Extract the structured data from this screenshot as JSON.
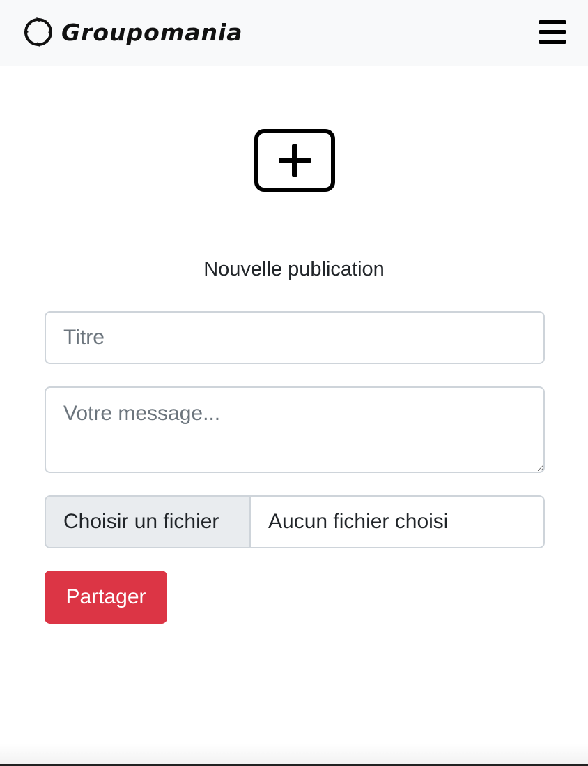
{
  "navbar": {
    "brand_name": "Groupomania",
    "logo_icon": "groupomania-logo-icon",
    "menu_icon": "hamburger-menu-icon"
  },
  "hero": {
    "icon": "plus-square-icon"
  },
  "form": {
    "title": "Nouvelle publication",
    "title_placeholder": "Titre",
    "title_value": "",
    "message_placeholder": "Votre message...",
    "message_value": "",
    "file_button_label": "Choisir un fichier",
    "file_status": "Aucun fichier choisi",
    "submit_label": "Partager"
  },
  "colors": {
    "navbar_background": "#f8f9fa",
    "submit_button": "#dc3545",
    "input_border": "#ced4da",
    "file_button_background": "#e9ecef",
    "placeholder_text": "#6c757d"
  }
}
